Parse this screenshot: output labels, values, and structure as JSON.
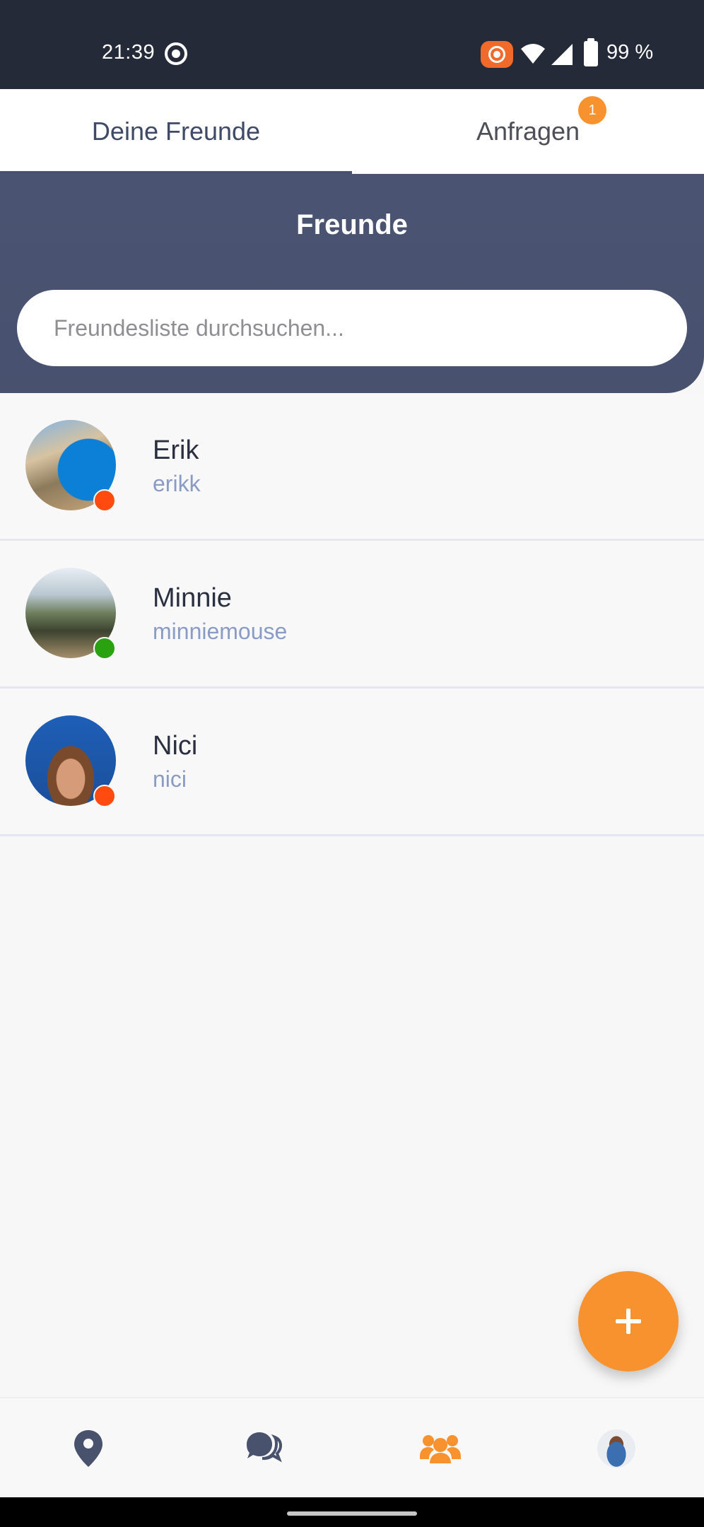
{
  "status_bar": {
    "time": "21:39",
    "battery_percent": "99 %",
    "icons": [
      "record-icon",
      "cast-icon",
      "wifi-icon",
      "signal-icon",
      "battery-icon"
    ],
    "cast_color": "#f26a2a"
  },
  "tabs": [
    {
      "label": "Deine Freunde",
      "active": true
    },
    {
      "label": "Anfragen",
      "active": false,
      "badge": "1"
    }
  ],
  "header": {
    "title": "Freunde",
    "background_color": "#4a5472"
  },
  "search": {
    "placeholder": "Freundesliste durchsuchen...",
    "value": ""
  },
  "friends": [
    {
      "name": "Erik",
      "username": "erikk",
      "status": "offline",
      "status_color": "#ff4a10"
    },
    {
      "name": "Minnie",
      "username": "minniemouse",
      "status": "online",
      "status_color": "#2aa10f"
    },
    {
      "name": "Nici",
      "username": "nici",
      "status": "offline",
      "status_color": "#ff4a10"
    }
  ],
  "fab": {
    "icon": "plus-icon",
    "color": "#f7922e"
  },
  "bottom_nav": [
    {
      "icon": "map-pin-icon",
      "active": false
    },
    {
      "icon": "chat-bubbles-icon",
      "active": false
    },
    {
      "icon": "friends-icon",
      "active": true
    },
    {
      "icon": "profile-avatar",
      "active": false
    }
  ],
  "colors": {
    "accent": "#f7922e",
    "primary": "#48526d",
    "username_text": "#8a9cc4"
  }
}
